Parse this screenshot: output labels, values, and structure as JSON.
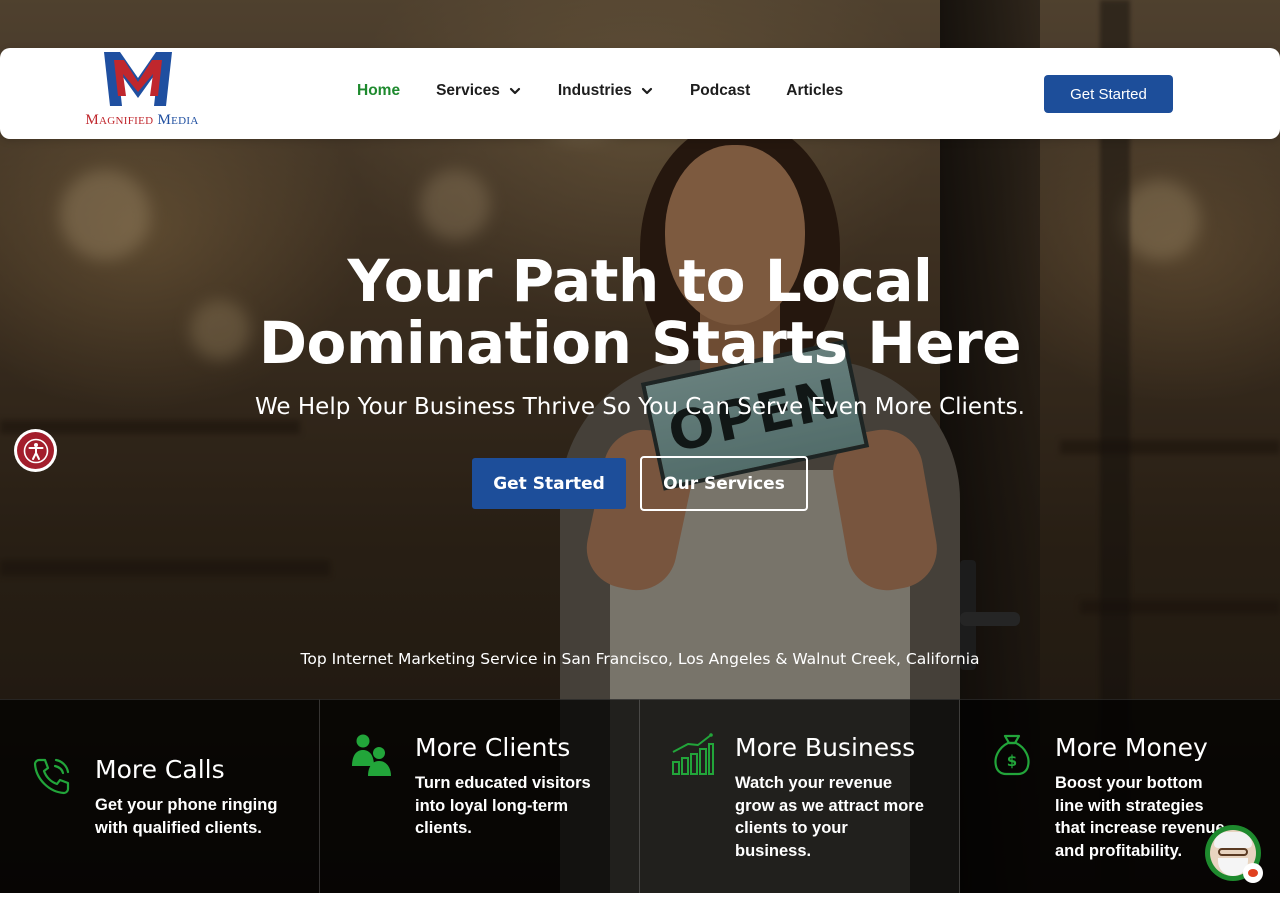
{
  "brand": {
    "logo_text_part1": "Magnified",
    "logo_text_part2": "Media",
    "logo_icon": "m-letter-logo",
    "colors": {
      "red": "#c0272d",
      "blue": "#1f4fa0"
    }
  },
  "nav": {
    "items": [
      {
        "label": "Home",
        "active": true,
        "has_dropdown": false
      },
      {
        "label": "Services",
        "active": false,
        "has_dropdown": true
      },
      {
        "label": "Industries",
        "active": false,
        "has_dropdown": true
      },
      {
        "label": "Podcast",
        "active": false,
        "has_dropdown": false
      },
      {
        "label": "Articles",
        "active": false,
        "has_dropdown": false
      }
    ],
    "cta_label": "Get Started",
    "active_color": "#1e8a2e",
    "cta_color": "#1d4e9a"
  },
  "hero": {
    "title_line1": "Your Path to Local",
    "title_line2": "Domination Starts Here",
    "subtitle": "We Help Your Business Thrive So You Can Serve Even More Clients.",
    "primary_button": "Get Started",
    "secondary_button": "Our Services",
    "tagline": "Top Internet Marketing Service in San Francisco, Los Angeles & Walnut Creek, California",
    "sign_text": "OPEN"
  },
  "features": [
    {
      "icon": "phone-icon",
      "title": "More Calls",
      "desc": "Get your phone ringing with qualified clients."
    },
    {
      "icon": "users-icon",
      "title": "More Clients",
      "desc": "Turn educated visitors into loyal long-term clients."
    },
    {
      "icon": "growth-chart-icon",
      "title": "More Business",
      "desc": "Watch your revenue grow as we attract more clients to your business."
    },
    {
      "icon": "money-bag-icon",
      "title": "More Money",
      "desc": "Boost your bottom line with strategies that increase revenue and profitability."
    }
  ],
  "widgets": {
    "accessibility_icon": "accessibility-icon",
    "chat_icon": "chat-avatar-icon",
    "accent_green": "#1e8a2e"
  }
}
